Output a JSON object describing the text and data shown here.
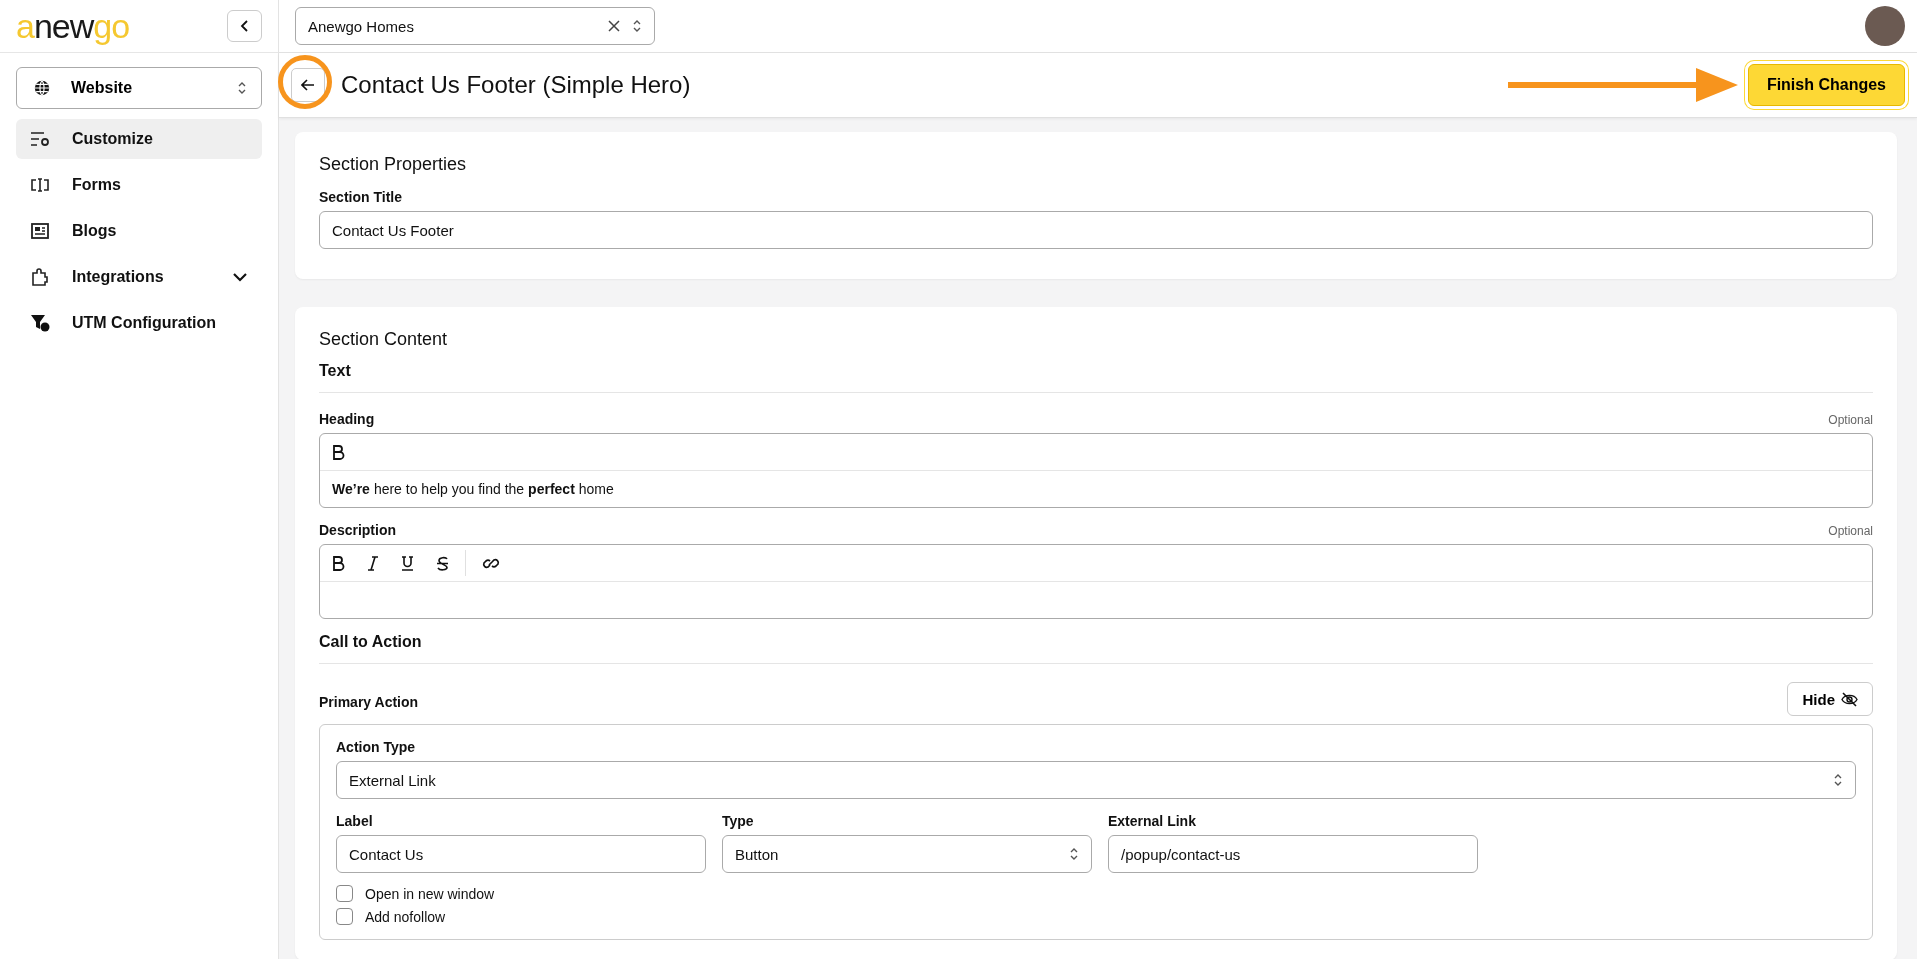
{
  "logo": {
    "parts": [
      {
        "text": "a",
        "color": "#f5c830"
      },
      {
        "text": "new",
        "color": "#1a1a1a"
      },
      {
        "text": "go",
        "color": "#f5c830"
      }
    ]
  },
  "community_select": {
    "value": "Anewgo Homes"
  },
  "sidebar": {
    "app_select": {
      "value": "Website"
    },
    "items": [
      {
        "label": "Customize",
        "selected": true,
        "expandable": false
      },
      {
        "label": "Forms",
        "selected": false,
        "expandable": false
      },
      {
        "label": "Blogs",
        "selected": false,
        "expandable": false
      },
      {
        "label": "Integrations",
        "selected": false,
        "expandable": true
      },
      {
        "label": "UTM Configuration",
        "selected": false,
        "expandable": false
      }
    ]
  },
  "header": {
    "title": "Contact Us Footer (Simple Hero)",
    "primary_button": "Finish Changes"
  },
  "section_properties": {
    "title": "Section Properties",
    "field_label": "Section Title",
    "field_value": "Contact Us Footer"
  },
  "section_content": {
    "title": "Section Content",
    "text_group": "Text",
    "heading": {
      "label": "Heading",
      "optional": "Optional",
      "value": "**We’re** here to help you find the **perfect** home"
    },
    "description": {
      "label": "Description",
      "optional": "Optional"
    },
    "cta_group": "Call to Action",
    "primary_action": {
      "label": "Primary Action",
      "hide_button": "Hide",
      "action_type": {
        "label": "Action Type",
        "value": "External Link"
      },
      "fields": [
        {
          "kind": "input",
          "label": "Label",
          "value": "Contact Us"
        },
        {
          "kind": "select",
          "label": "Type",
          "value": "Button"
        },
        {
          "kind": "input",
          "label": "External Link",
          "value": "/popup/contact-us"
        }
      ],
      "options": [
        {
          "label": "Open in new window",
          "checked": false
        },
        {
          "label": "Add nofollow",
          "checked": false
        }
      ]
    }
  }
}
